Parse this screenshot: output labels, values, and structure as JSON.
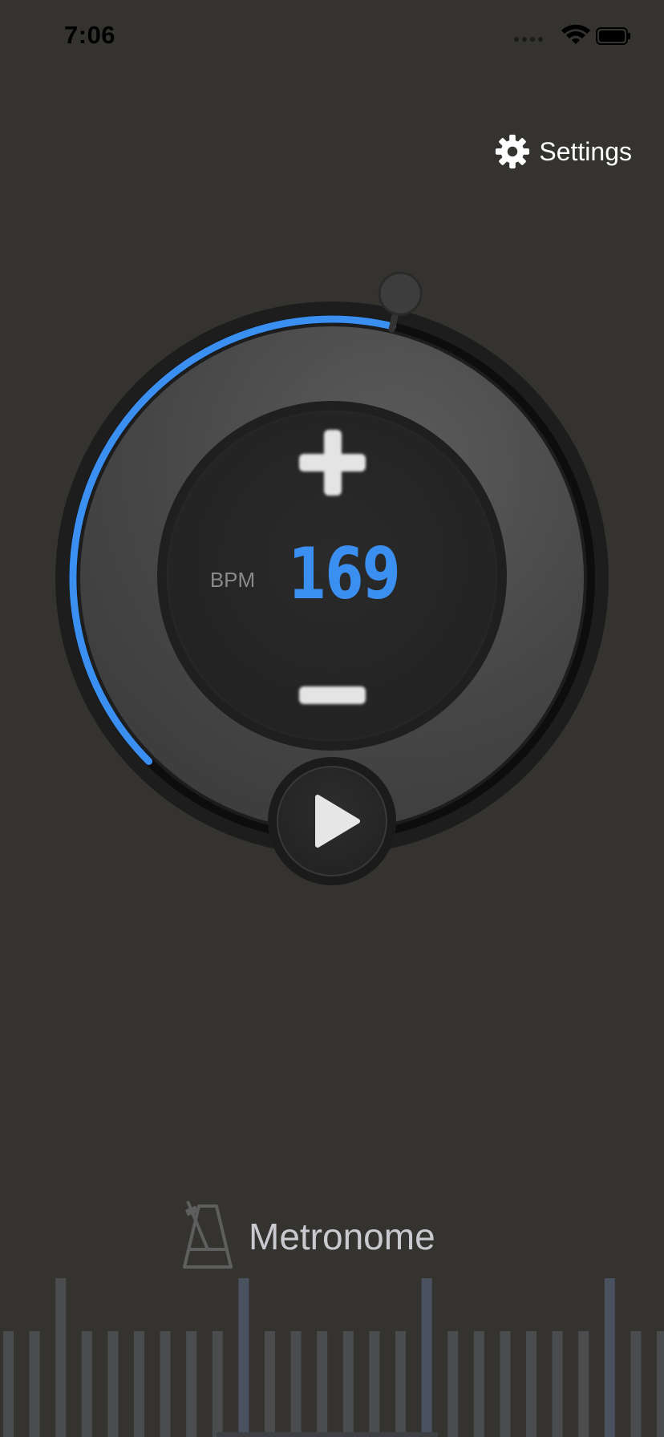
{
  "status_bar": {
    "time": "7:06",
    "icons": [
      "cellular-signal-icon",
      "wifi-icon",
      "battery-icon"
    ]
  },
  "header": {
    "settings_label": "Settings",
    "settings_icon": "gear-icon"
  },
  "dial": {
    "bpm_label": "BPM",
    "bpm_value": "169",
    "increment_icon": "plus-icon",
    "decrement_icon": "minus-icon",
    "play_icon": "play-icon",
    "tempo_fraction": 0.55,
    "accent_color": "#3a8ff0"
  },
  "footer": {
    "app_title": "Metronome",
    "app_icon": "metronome-icon"
  }
}
